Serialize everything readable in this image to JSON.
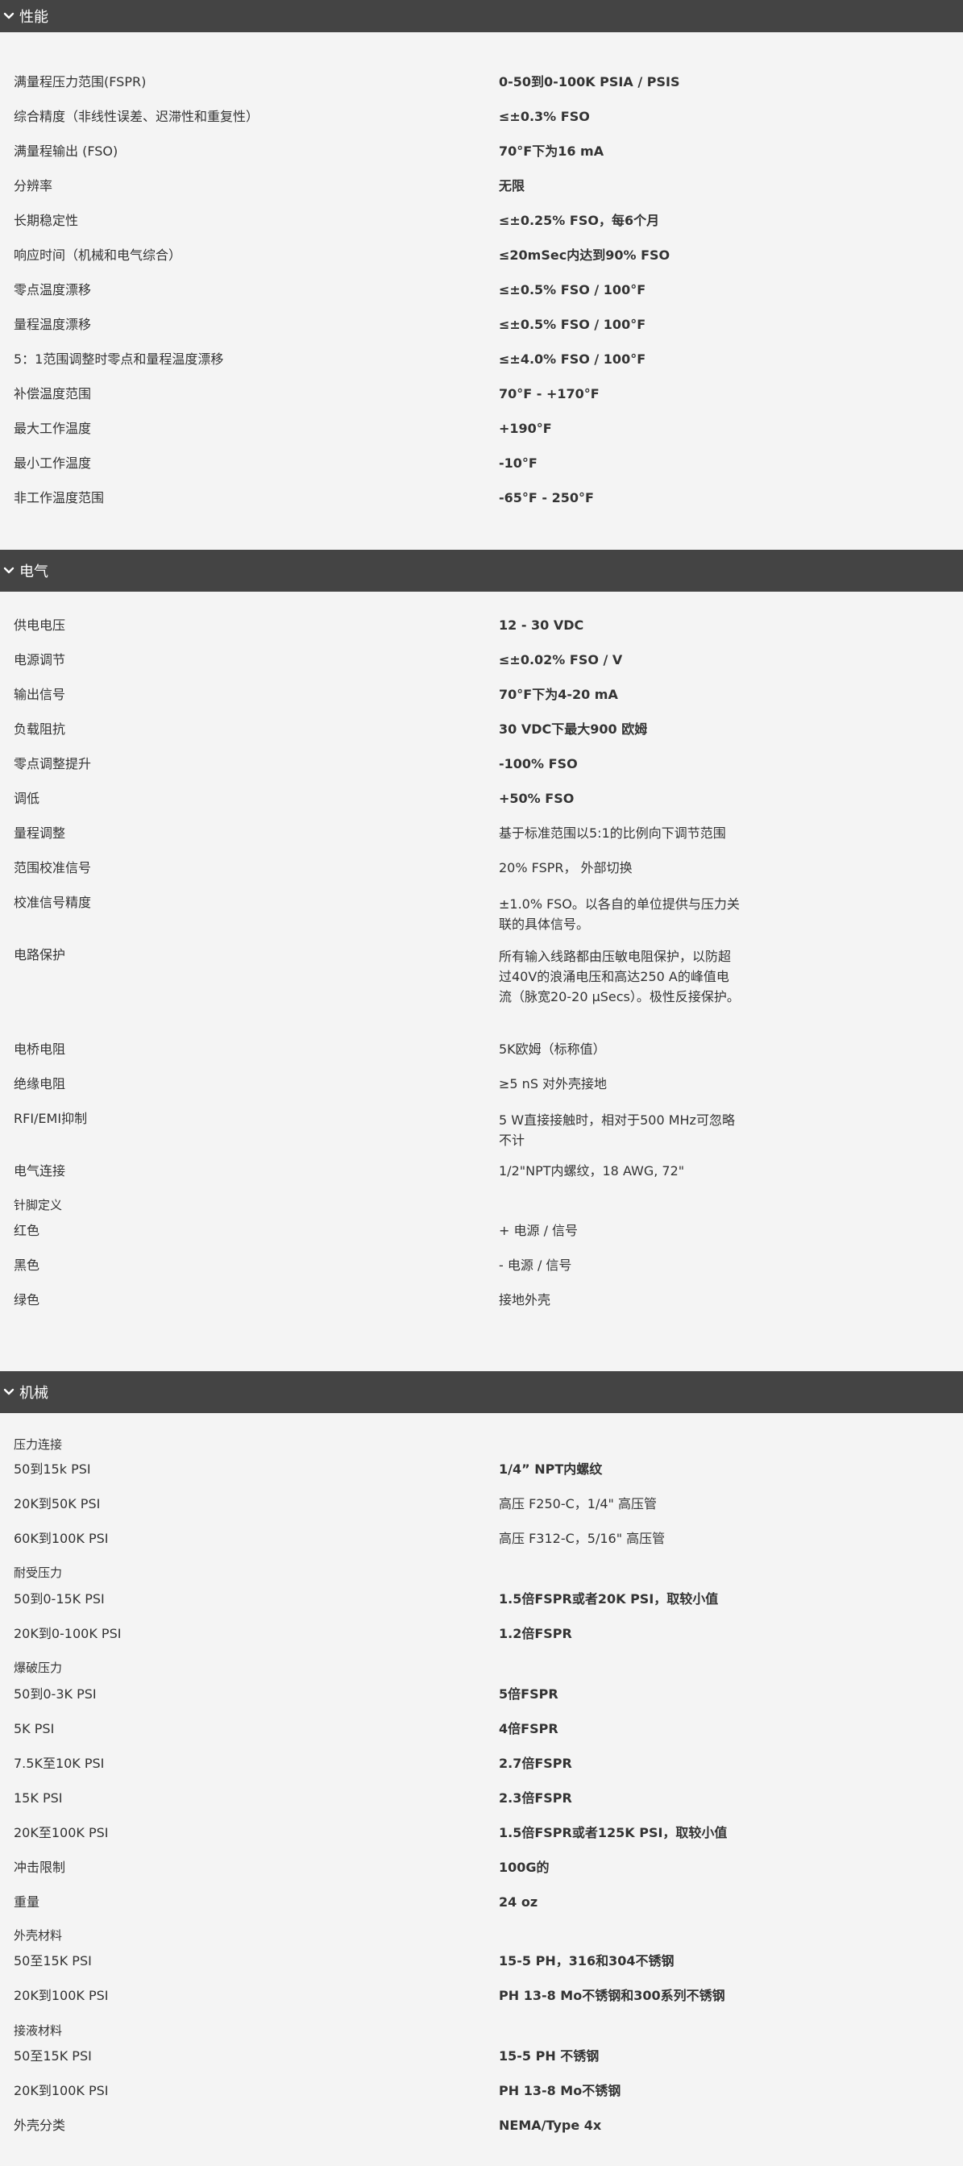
{
  "sections": [
    {
      "title": "性能",
      "rows": [
        {
          "label": "满量程压力范围(FSPR)",
          "value": "0-50到0-100K PSIA / PSIS"
        },
        {
          "label": "综合精度（非线性误差、迟滞性和重复性）",
          "value": "≤±0.3% FSO"
        },
        {
          "label": "满量程输出 (FSO)",
          "value": "70°F下为16 mA"
        },
        {
          "label": "分辨率",
          "value": "无限"
        },
        {
          "label": "长期稳定性",
          "value": "≤±0.25% FSO，每6个月"
        },
        {
          "label": "响应时间（机械和电气综合）",
          "value": "≤20mSec内达到90% FSO"
        },
        {
          "label": "零点温度漂移",
          "value": "≤±0.5% FSO / 100°F"
        },
        {
          "label": "量程温度漂移",
          "value": "≤±0.5% FSO / 100°F"
        },
        {
          "label": "5：1范围调整时零点和量程温度漂移",
          "value": "≤±4.0% FSO / 100°F"
        },
        {
          "label": "补偿温度范围",
          "value": "70°F - +170°F"
        },
        {
          "label": "最大工作温度",
          "value": "+190°F"
        },
        {
          "label": "最小工作温度",
          "value": "-10°F"
        },
        {
          "label": "非工作温度范围",
          "value": "-65°F - 250°F"
        }
      ]
    },
    {
      "title": "电气",
      "rows": [
        {
          "label": "供电电压",
          "value": "12 - 30 VDC"
        },
        {
          "label": "电源调节",
          "value": "≤±0.02% FSO / V"
        },
        {
          "label": "输出信号",
          "value": "70°F下为4-20 mA"
        },
        {
          "label": "负载阻抗",
          "value": "30 VDC下最大900 欧姆"
        },
        {
          "label": "零点调整提升",
          "value": "-100% FSO"
        },
        {
          "label": "调低",
          "value": "+50% FSO"
        },
        {
          "label": "量程调整",
          "value": "基于标准范围以5:1的比例向下调节范围"
        },
        {
          "label": "范围校准信号",
          "value": "20% FSPR， 外部切换"
        },
        {
          "label": "校准信号精度",
          "value": "±1.0% FSO。以各自的单位提供与压力关联的具体信号。"
        },
        {
          "label": "电路保护",
          "value": "所有输入线路都由压敏电阻保护，以防超过40V的浪涌电压和高达250 A的峰值电流（脉宽20-20 μSecs）。极性反接保护。"
        },
        {
          "label": "电桥电阻",
          "value": "5K欧姆（标称值）"
        },
        {
          "label": "绝缘电阻",
          "value": "≥5 nS 对外壳接地"
        },
        {
          "label": "RFI/EMI抑制",
          "value": "5 W直接接触时，相对于500 MHz可忽略不计"
        },
        {
          "label": "电气连接",
          "value": "1/2\"NPT内螺纹，18 AWG, 72\""
        },
        {
          "label": "针脚定义",
          "value": ""
        },
        {
          "label": "红色",
          "value": "+ 电源 / 信号"
        },
        {
          "label": "黑色",
          "value": "- 电源 / 信号"
        },
        {
          "label": "绿色",
          "value": "接地外壳"
        }
      ]
    },
    {
      "title": "机械",
      "rows": [
        {
          "label": "压力连接",
          "value": ""
        },
        {
          "label": "50到15k PSI",
          "value": "1/4”  NPT内螺纹"
        },
        {
          "label": "20K到50K PSI",
          "value": "高压 F250-C，1/4\" 高压管"
        },
        {
          "label": "60K到100K PSI",
          "value": "高压 F312-C，5/16\" 高压管"
        },
        {
          "label": "耐受压力",
          "value": ""
        },
        {
          "label": "50到0-15K PSI",
          "value": "1.5倍FSPR或者20K PSI，取较小值"
        },
        {
          "label": "20K到0-100K PSI",
          "value": "1.2倍FSPR"
        },
        {
          "label": "爆破压力",
          "value": ""
        },
        {
          "label": "50到0-3K PSI",
          "value": "5倍FSPR"
        },
        {
          "label": "5K PSI",
          "value": "4倍FSPR"
        },
        {
          "label": "7.5K至10K PSI",
          "value": "2.7倍FSPR"
        },
        {
          "label": "15K PSI",
          "value": "2.3倍FSPR"
        },
        {
          "label": "20K至100K PSI",
          "value": "1.5倍FSPR或者125K PSI，取较小值"
        },
        {
          "label": "冲击限制",
          "value": "100G的"
        },
        {
          "label": "重量",
          "value": "24 oz"
        },
        {
          "label": "外壳材料",
          "value": ""
        },
        {
          "label": "50至15K PSI",
          "value": "15-5 PH，316和304不锈钢"
        },
        {
          "label": "20K到100K PSI",
          "value": "PH 13-8 Mo不锈钢和300系列不锈钢"
        },
        {
          "label": "接液材料",
          "value": ""
        },
        {
          "label": "50至15K PSI",
          "value": "15-5 PH 不锈钢"
        },
        {
          "label": "20K到100K PSI",
          "value": "PH 13-8 Mo不锈钢"
        },
        {
          "label": "外壳分类",
          "value": "NEMA/Type 4x"
        }
      ]
    }
  ]
}
